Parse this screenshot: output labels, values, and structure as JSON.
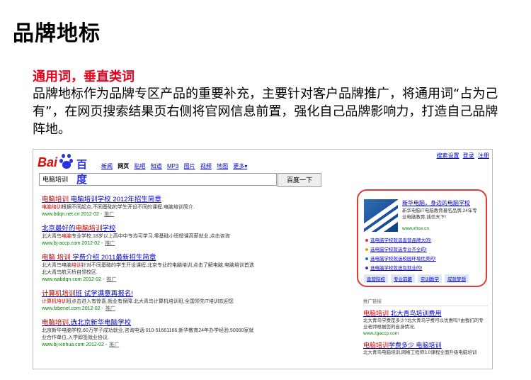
{
  "slide": {
    "title": "品牌地标",
    "subhead": "通用词，垂直类词",
    "body": "品牌地标作为品牌专区产品的重要补充，主要针对客户品牌推广，将通用词“占为己有”，在网页搜索结果页右侧将官网信息前置，强化自己品牌影响力，打造自己品牌阵地。"
  },
  "browser": {
    "top_links": [
      "搜索设置",
      "登录",
      "注册"
    ],
    "logo": {
      "left": "Bai",
      "right": "百度"
    },
    "nav": [
      "新闻",
      "网页",
      "贴吧",
      "知道",
      "MP3",
      "图片",
      "视频",
      "地图",
      "更多▾"
    ],
    "nav_active": "网页",
    "search_value": "电脑培训",
    "search_button": "百度一下",
    "results": [
      {
        "title_pre": "",
        "title_em": "电脑培训",
        "title_post": " 电脑培训学校 2012年招生简章",
        "desc_pre": "",
        "desc_em": "电脑培训",
        "desc_post": "根据不同起点,不同基础的学生开设不同的课程,电脑培训简介.",
        "url": "www.bdqn.net.cn 2012-02 -",
        "ad": "推广"
      },
      {
        "title_pre": "北京最好的",
        "title_em": "电脑培训",
        "title_post": "学校",
        "desc_pre": "北大青鸟",
        "desc_em": "电脑",
        "desc_post": "专业学校,18岁以上高中中专均可学习,零基础小班授课高薪就业,点击咨询",
        "url": "www.bj-accp.com 2012-02 -",
        "ad": "推广"
      },
      {
        "title_pre": "",
        "title_em": "电脑 培训",
        "title_post": " 学费介绍 2011最新招生简章",
        "desc_pre": "北大青鸟电脑",
        "desc_em": "培训",
        "desc_post": "针对不同基础的学生开设课程,北京专业的电脑培训,点击了解电脑,电脑培训首选北大青鸟航天桥自领校区.",
        "url": "www.wabdqn.com 2012-02 -",
        "ad": "推广"
      },
      {
        "title_pre": "",
        "title_em": "计算机培训",
        "title_post": "班 试学满意再报名!",
        "desc_pre": "",
        "desc_em": "计算机培训",
        "desc_post": "班点击进入有惊喜,就业有保障.北大青鸟计算机培训班,全国领先IT培训欢迎您",
        "url": "www.fzbenet.com 2012-02 -",
        "ad": "推广"
      },
      {
        "title_pre": "",
        "title_em": "电脑培训",
        "title_post": ",选北京新华电脑学校",
        "desc_pre": "北京新华电脑学校,60万学子成功就业,咨询电话:010-51661166,新华教育24年办学经验,50000家就业合作单位,入学即签就业协议.",
        "desc_em": "",
        "desc_post": "",
        "url": "www.bj-xinhua.com 2012-02 -",
        "ad": "推广"
      }
    ],
    "brand_box": {
      "title": "新华电脑，身边的电脑学校",
      "desc": "新华电脑IT电脑教育著名品牌,24年专业电脑教育,诚信天下!",
      "url": "www.xhce.cn",
      "links": [
        "选电脑学校就选直营品牌大的!",
        "选电脑学校就选专业齐全的!",
        "选电脑学校就选校园环境优美的!",
        "选电脑学校就选包就业的!"
      ],
      "bullet_colors": [
        "#e03a2e",
        "#e0a000",
        "#2d6db5",
        "#5a2da0"
      ],
      "tabs": [
        "直营院校",
        "专业前瞻",
        "实训教学",
        "成就梦想"
      ]
    },
    "right_ads": {
      "label": "推广链接",
      "items": [
        {
          "title_em": "电脑培训",
          "title_post": " 北大青鸟培训费用",
          "desc": "北大青鸟学费是多少?北大青鸟学费可以优惠吗?由我们的专业老师根据您的自身情况,",
          "url": "www.zgaccp.com"
        },
        {
          "title_em": "电脑培训",
          "title_post": "学费多少 电脑培训",
          "desc": "北大青鸟电脑培训,网络工程师3.0课程全面升级电脑培训",
          "url": ""
        }
      ]
    }
  }
}
